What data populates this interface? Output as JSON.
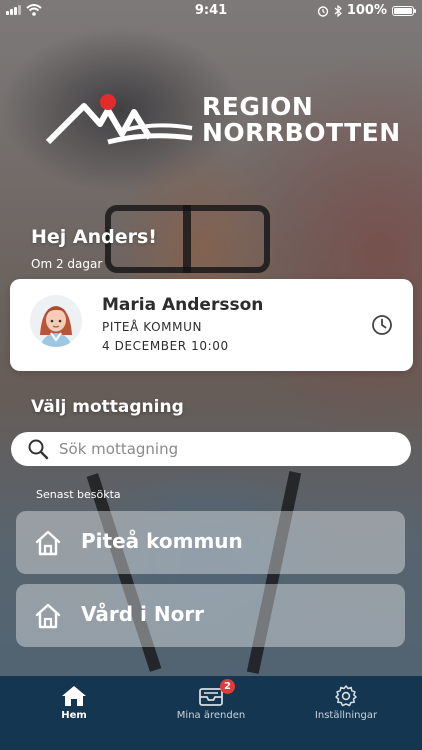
{
  "status_bar": {
    "time": "9:41",
    "battery": "100%",
    "icons": [
      "signal-icon",
      "wifi-icon",
      "alarm-icon",
      "bluetooth-icon",
      "battery-icon"
    ]
  },
  "logo": {
    "line1": "REGION",
    "line2": "NORRBOTTEN",
    "accent_color": "#e32b2b"
  },
  "greeting": {
    "title": "Hej Anders!",
    "subtitle": "Om 2 dagar"
  },
  "appointment": {
    "name": "Maria Andersson",
    "place": "PITEÅ KOMMUN",
    "when": "4 DECEMBER 10:00",
    "icon": "clock-icon"
  },
  "clinics": {
    "title": "Välj mottagning",
    "search_placeholder": "Sök mottagning",
    "recent_label": "Senast besökta",
    "items": [
      {
        "label": "Piteå kommun",
        "icon": "home-icon"
      },
      {
        "label": "Vård i Norr",
        "icon": "home-icon"
      }
    ]
  },
  "tabbar": {
    "background": "#143650",
    "tabs": [
      {
        "label": "Hem",
        "icon": "home-icon",
        "active": true
      },
      {
        "label": "Mina ärenden",
        "icon": "inbox-icon",
        "badge": "2",
        "active": false
      },
      {
        "label": "Inställningar",
        "icon": "gear-icon",
        "active": false
      }
    ]
  }
}
